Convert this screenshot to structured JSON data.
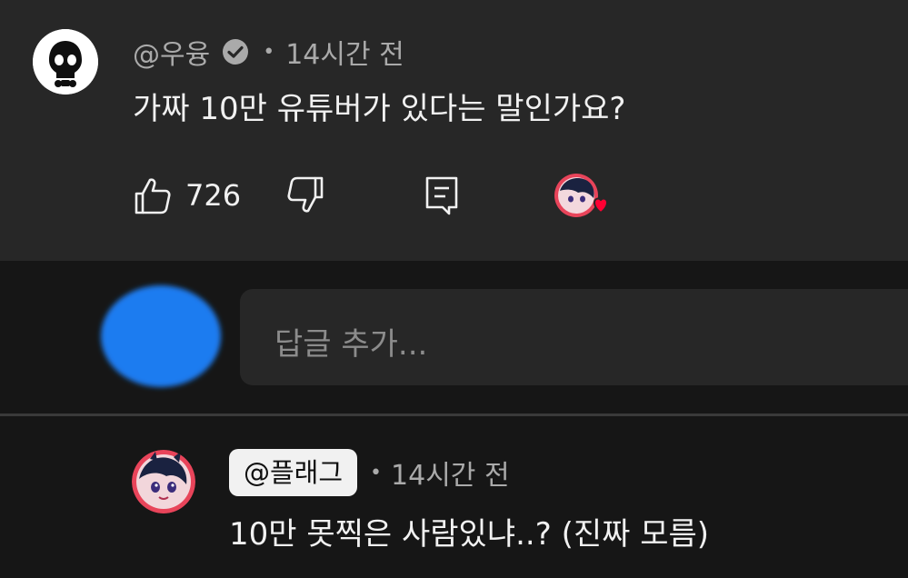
{
  "comment": {
    "author": "@우융",
    "time": "14시간 전",
    "text": "가짜 10만 유튜버가 있다는 말인가요?",
    "likes": "726",
    "author_avatar_icon": "skull-icon",
    "verified_icon": "verified-check-icon"
  },
  "reply_box": {
    "placeholder": "답글 추가..."
  },
  "reply": {
    "author": "@플래그",
    "time": "14시간 전",
    "text": "10만 못찍은 사람있냐..? (진짜 모름)"
  },
  "separator": "•",
  "colors": {
    "panel": "#272727",
    "background": "#161616",
    "text": "#f1f1f1",
    "muted": "#aaaaaa",
    "heart": "#ff0033",
    "blur_avatar": "#1c7cf0"
  }
}
